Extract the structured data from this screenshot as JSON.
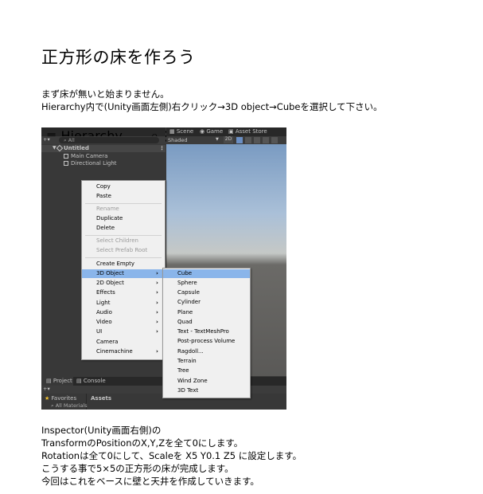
{
  "title": "正方形の床を作ろう",
  "intro": {
    "line1": "まず床が無いと始まりません。",
    "line2": "Hierarchy内で(Unity画面左側)右クリック→3D object→Cubeを選択して下さい。"
  },
  "screenshot": {
    "hierarchy_tab": "Hierarchy",
    "search_placeholder": "All",
    "scene_tab": "Scene",
    "game_tab": "Game",
    "asset_store_tab": "Asset Store",
    "shading_mode": "Shaded",
    "mode_2d": "2D",
    "scene_root": "Untitled",
    "objects": [
      "Main Camera",
      "Directional Light"
    ],
    "context_menu": [
      {
        "label": "Copy",
        "disabled": false,
        "submenu": false
      },
      {
        "label": "Paste",
        "disabled": false,
        "submenu": false
      },
      {
        "label": "Rename",
        "disabled": true,
        "submenu": false
      },
      {
        "label": "Duplicate",
        "disabled": false,
        "submenu": false
      },
      {
        "label": "Delete",
        "disabled": false,
        "submenu": false
      },
      {
        "label": "Select Children",
        "disabled": true,
        "submenu": false
      },
      {
        "label": "Select Prefab Root",
        "disabled": true,
        "submenu": false
      },
      {
        "label": "Create Empty",
        "disabled": false,
        "submenu": false
      },
      {
        "label": "3D Object",
        "disabled": false,
        "submenu": true,
        "selected": true
      },
      {
        "label": "2D Object",
        "disabled": false,
        "submenu": true
      },
      {
        "label": "Effects",
        "disabled": false,
        "submenu": true
      },
      {
        "label": "Light",
        "disabled": false,
        "submenu": true
      },
      {
        "label": "Audio",
        "disabled": false,
        "submenu": true
      },
      {
        "label": "Video",
        "disabled": false,
        "submenu": true
      },
      {
        "label": "UI",
        "disabled": false,
        "submenu": true
      },
      {
        "label": "Camera",
        "disabled": false,
        "submenu": false
      },
      {
        "label": "Cinemachine",
        "disabled": false,
        "submenu": true
      }
    ],
    "submenu_3d": [
      "Cube",
      "Sphere",
      "Capsule",
      "Cylinder",
      "Plane",
      "Quad",
      "Text - TextMeshPro",
      "Post-process Volume",
      "Ragdoll...",
      "Terrain",
      "Tree",
      "Wind Zone",
      "3D Text"
    ],
    "project_tab": "Project",
    "console_tab": "Console",
    "favorites": "Favorites",
    "assets": "Assets",
    "all_materials": "All Materials"
  },
  "instructions": {
    "line1": "Inspector(Unity画面右側)の",
    "line2": "TransformのPositionのX,Y,Zを全て0にします。",
    "line3": "Rotationは全て0にして、Scaleを X5 Y0.1 Z5 に設定します。",
    "line4": "こうする事で5×5の正方形の床が完成します。",
    "line5": "今回はこれをベースに壁と天井を作成していきます。"
  }
}
